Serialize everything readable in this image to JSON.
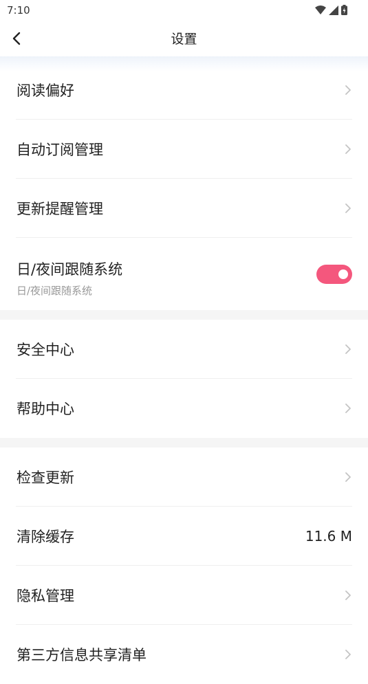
{
  "status_bar": {
    "time": "7:10",
    "icons": [
      "wifi-icon",
      "signal-icon",
      "battery-icon"
    ]
  },
  "nav": {
    "title": "设置",
    "back_icon": "chevron-left-icon"
  },
  "sections": [
    {
      "items": [
        {
          "label": "阅读偏好",
          "type": "link"
        },
        {
          "label": "自动订阅管理",
          "type": "link"
        },
        {
          "label": "更新提醒管理",
          "type": "link"
        },
        {
          "label": "日/夜间跟随系统",
          "subtitle": "日/夜间跟随系统",
          "type": "toggle",
          "on": true
        }
      ]
    },
    {
      "items": [
        {
          "label": "安全中心",
          "type": "link"
        },
        {
          "label": "帮助中心",
          "type": "link"
        }
      ]
    },
    {
      "items": [
        {
          "label": "检查更新",
          "type": "link"
        },
        {
          "label": "清除缓存",
          "type": "value",
          "value": "11.6 M"
        },
        {
          "label": "隐私管理",
          "type": "link"
        },
        {
          "label": "第三方信息共享清单",
          "type": "link"
        }
      ]
    }
  ],
  "colors": {
    "toggle_on": "#f4577d",
    "section_gap": "#f5f5f5",
    "chevron": "#c4c4c4"
  }
}
